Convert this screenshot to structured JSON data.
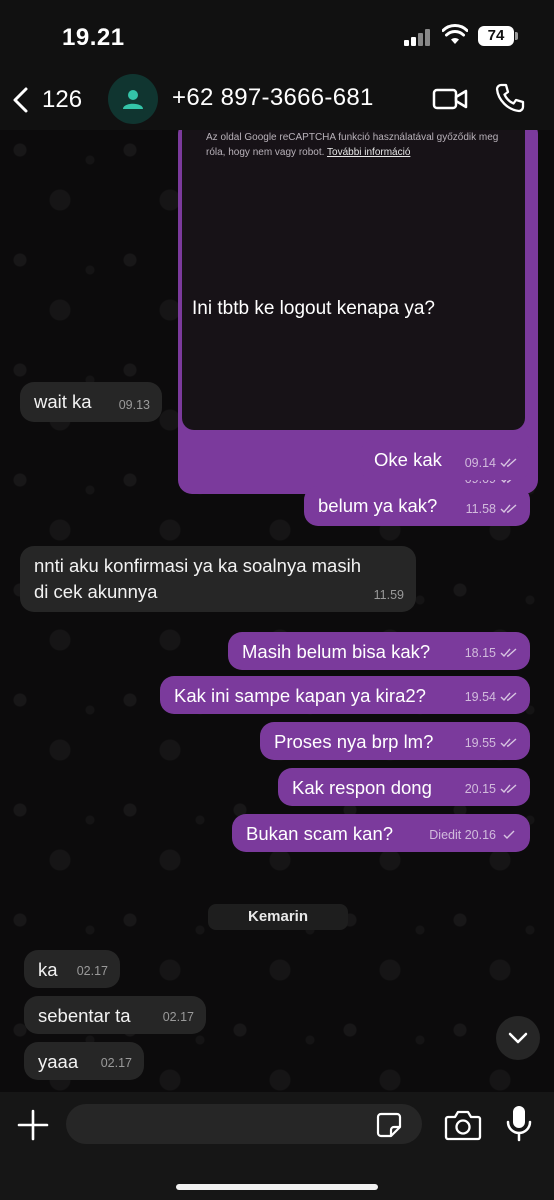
{
  "status_bar": {
    "time": "19.21",
    "battery": "74"
  },
  "header": {
    "back_count": "126",
    "contact_name": "+62 897-3666-681"
  },
  "image_message": {
    "recaptcha_text": "Az oldal Google reCAPTCHA funkció használatával győződik meg róla, hogy nem vagy robot.",
    "recaptcha_link": "További információ",
    "caption": "Ini tbtb ke logout kenapa ya?",
    "time": "09.09"
  },
  "messages": [
    {
      "text": "wait ka",
      "time": "09.13",
      "dir": "in"
    },
    {
      "text": "Oke kak",
      "time": "09.14",
      "dir": "out"
    },
    {
      "text": "belum ya kak?",
      "time": "11.58",
      "dir": "out"
    },
    {
      "line1": "nnti aku konfirmasi ya ka soalnya masih",
      "line2": "di cek akunnya",
      "time": "11.59",
      "dir": "in"
    },
    {
      "text": "Masih belum bisa kak?",
      "time": "18.15",
      "dir": "out"
    },
    {
      "text": "Kak ini sampe kapan ya kira2?",
      "time": "19.54",
      "dir": "out"
    },
    {
      "text": "Proses nya brp lm?",
      "time": "19.55",
      "dir": "out"
    },
    {
      "text": "Kak respon dong",
      "time": "20.15",
      "dir": "out"
    },
    {
      "text": "Bukan scam kan?",
      "time": "Diedit 20.16",
      "dir": "out"
    },
    {
      "text": "ka",
      "time": "02.17",
      "dir": "in"
    },
    {
      "text": "sebentar ta",
      "time": "02.17",
      "dir": "in"
    },
    {
      "text": "yaaa",
      "time": "02.17",
      "dir": "in"
    }
  ],
  "date_separator": "Kemarin",
  "input": {
    "placeholder": ""
  },
  "colors": {
    "outgoing": "#7b3a9c",
    "incoming": "#262626",
    "avatar_bg": "#103530",
    "avatar_icon": "#34c4a8"
  }
}
